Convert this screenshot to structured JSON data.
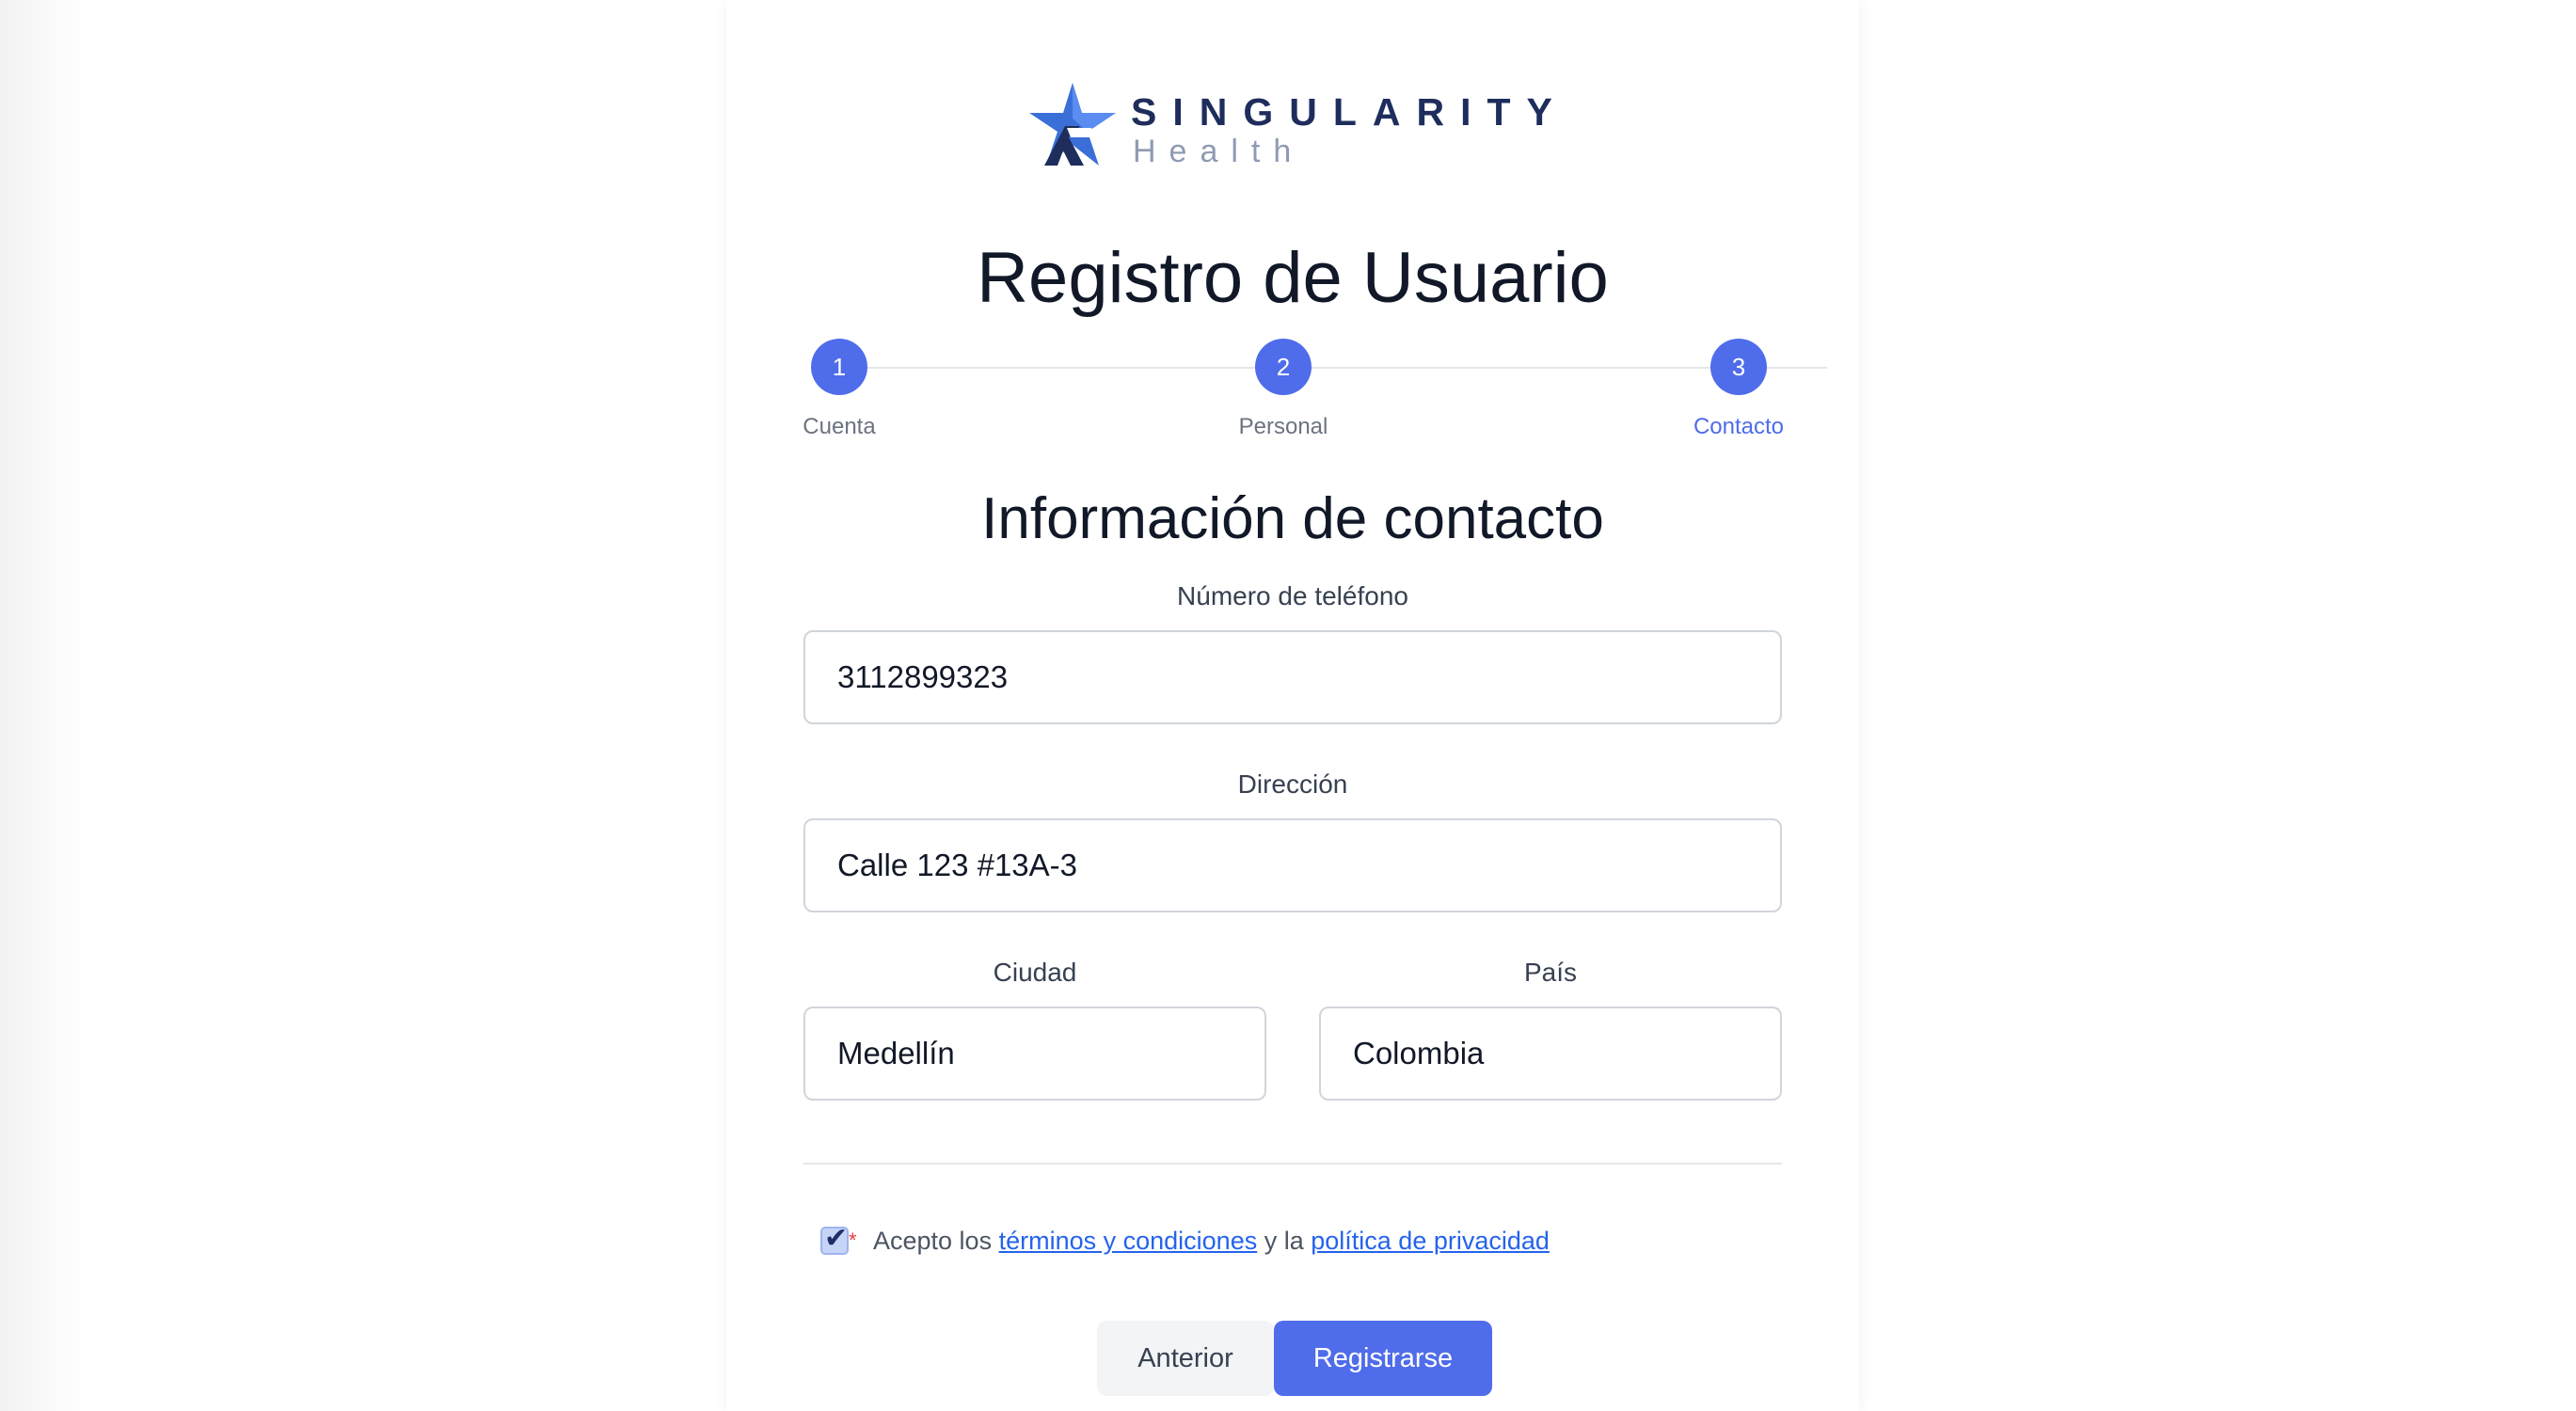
{
  "brand": {
    "name_top": "SINGULARITY",
    "name_bottom": "Health"
  },
  "page": {
    "title": "Registro de Usuario"
  },
  "stepper": {
    "steps": [
      {
        "number": "1",
        "label": "Cuenta"
      },
      {
        "number": "2",
        "label": "Personal"
      },
      {
        "number": "3",
        "label": "Contacto"
      }
    ],
    "active_step": 3
  },
  "section": {
    "title": "Información de contacto"
  },
  "form": {
    "phone": {
      "label": "Número de teléfono",
      "value": "3112899323"
    },
    "address": {
      "label": "Dirección",
      "value": "Calle 123 #13A-3"
    },
    "city": {
      "label": "Ciudad",
      "value": "Medellín"
    },
    "country": {
      "label": "País",
      "value": "Colombia"
    }
  },
  "terms": {
    "checked": true,
    "required_mark": "*",
    "prefix": "Acepto los ",
    "terms_link": "términos y condiciones",
    "middle": " y la ",
    "privacy_link": "política de privacidad"
  },
  "buttons": {
    "previous": "Anterior",
    "submit": "Registrarse"
  },
  "colors": {
    "primary": "#4f6cea",
    "link": "#2563eb",
    "brand_dark": "#1e2d5c",
    "required": "#e53e3e"
  }
}
